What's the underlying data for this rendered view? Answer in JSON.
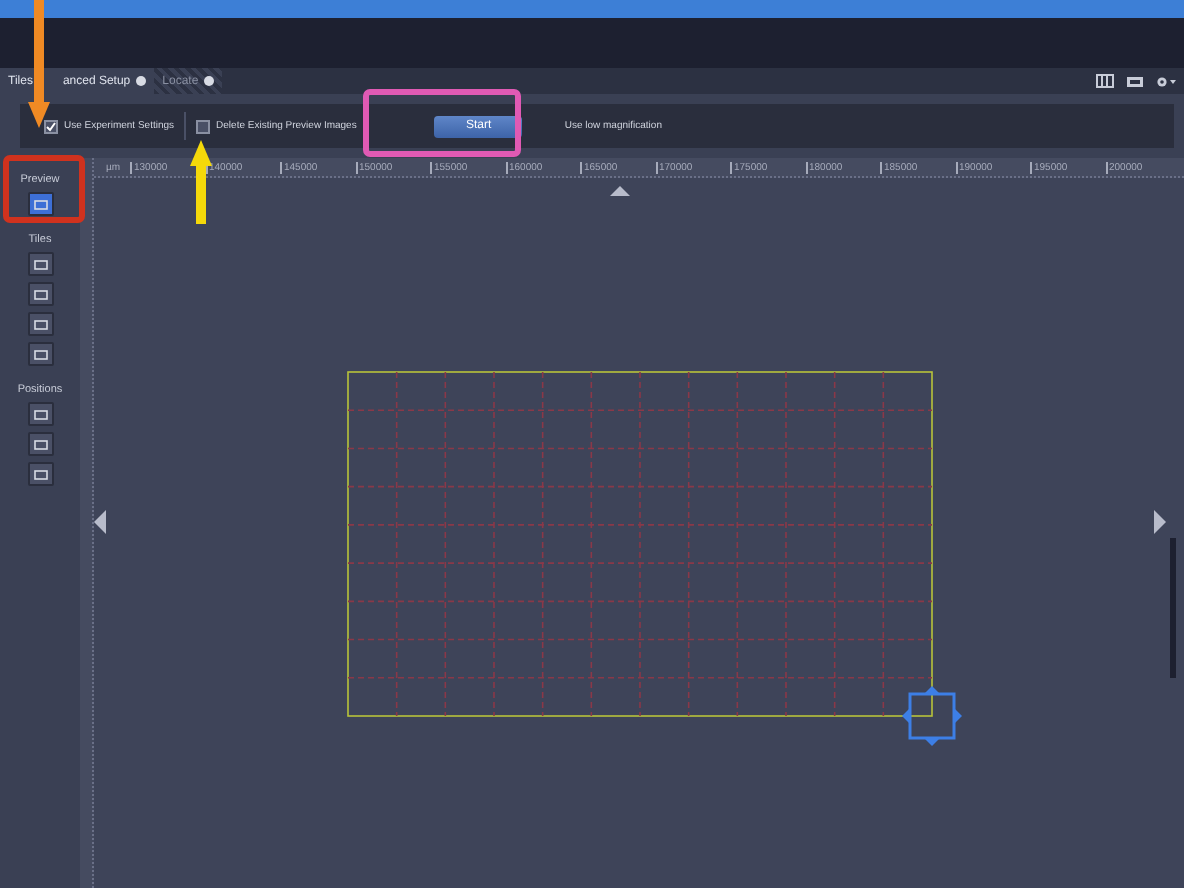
{
  "tabs": [
    {
      "label_parts": [
        "Tiles",
        "anced Setup"
      ],
      "selected": true
    },
    {
      "label_parts": [
        "Locate"
      ],
      "selected": false
    }
  ],
  "toolbar": {
    "options": [
      {
        "label": "Use Experiment Settings",
        "checked": true
      },
      {
        "label": "Delete Existing Preview Images",
        "checked": false
      }
    ],
    "start_button": "Start",
    "low_magnification": "Use low magnification"
  },
  "ruler": {
    "unit": "µm",
    "ticks": [
      "130000",
      "140000",
      "145000",
      "150000",
      "155000",
      "160000",
      "165000",
      "170000",
      "175000",
      "180000",
      "185000",
      "190000",
      "195000",
      "200000"
    ]
  },
  "sidebar": {
    "sections": [
      {
        "title": "Preview",
        "tools": [
          {
            "selected": true
          }
        ]
      },
      {
        "title": "Tiles",
        "tools": [
          {
            "selected": false
          },
          {
            "selected": false
          },
          {
            "selected": false
          },
          {
            "selected": false
          }
        ]
      },
      {
        "title": "Positions",
        "tools": [
          {
            "selected": false
          },
          {
            "selected": false
          },
          {
            "selected": false
          }
        ]
      }
    ]
  },
  "annotations": [
    {
      "kind": "arrow-down",
      "color": "#f08a24"
    },
    {
      "kind": "arrow-up",
      "color": "#f5d90a"
    },
    {
      "kind": "box",
      "color": "#d0321e"
    },
    {
      "kind": "box",
      "color": "#e05ab4"
    }
  ]
}
